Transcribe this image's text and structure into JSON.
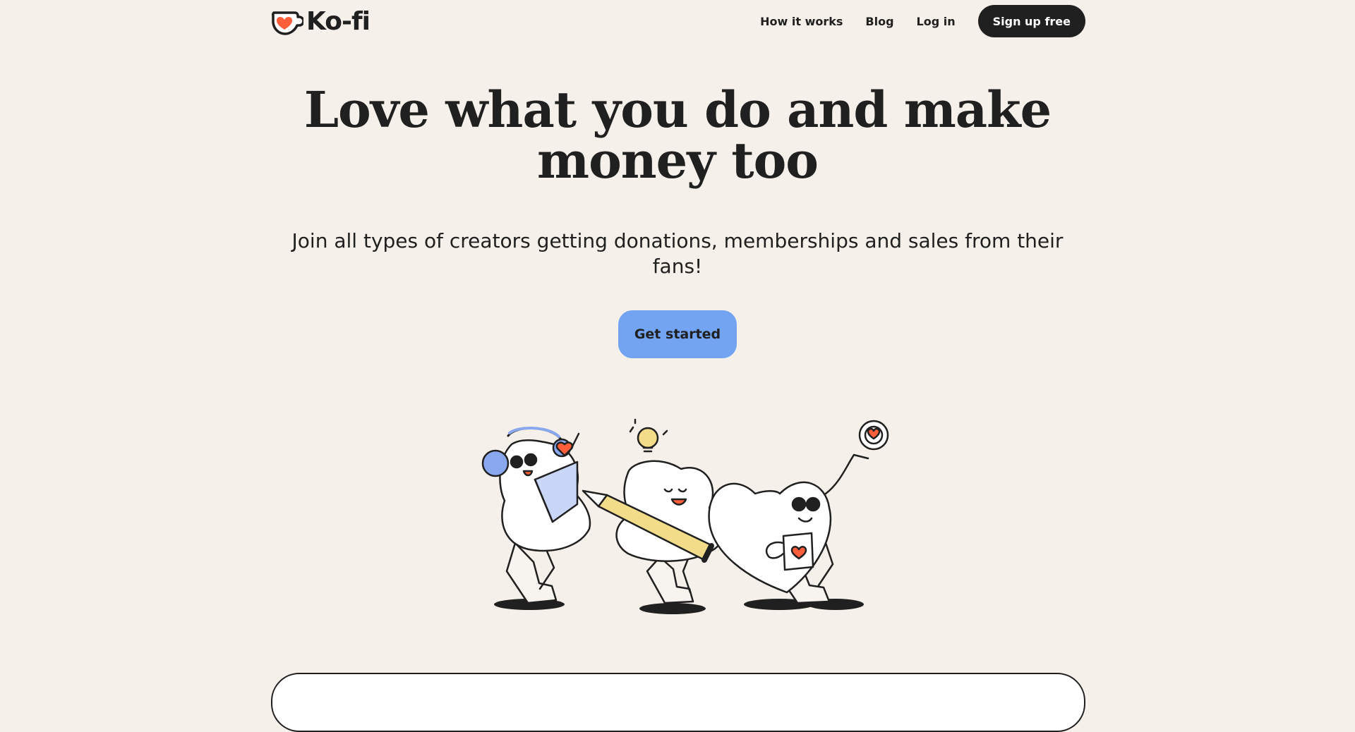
{
  "nav": {
    "logo_text": "Ko-fi",
    "links": [
      {
        "label": "How it works"
      },
      {
        "label": "Blog"
      },
      {
        "label": "Log in"
      }
    ],
    "signup_label": "Sign up free"
  },
  "hero": {
    "title_line1": "Love what you do and make",
    "title_line2": "money too",
    "subtitle": "Join all types of creators getting donations, memberships and sales from their fans!",
    "cta_label": "Get started"
  },
  "colors": {
    "background": "#f5f0e9",
    "ink": "#202020",
    "cta": "#72a4f2",
    "heart": "#ff5e3a",
    "pencil": "#f2dc8a",
    "headphones": "#8aa8ee"
  },
  "icons": {
    "logo": "ko-fi-cup-heart-icon",
    "illustration": "creator-characters-illustration"
  }
}
